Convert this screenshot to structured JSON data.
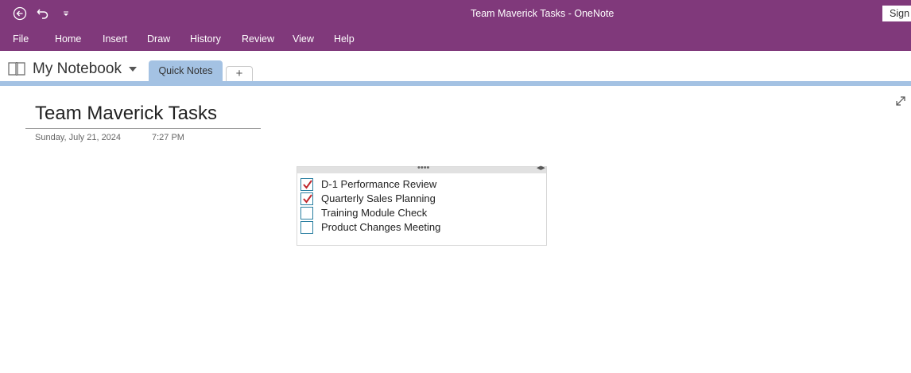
{
  "window": {
    "title": "Team Maverick Tasks  -  OneNote",
    "signin_label": "Sign"
  },
  "menu": {
    "items": [
      "File",
      "Home",
      "Insert",
      "Draw",
      "History",
      "Review",
      "View",
      "Help"
    ]
  },
  "notebook": {
    "name": "My Notebook",
    "active_tab": "Quick Notes",
    "add_tab_label": "+"
  },
  "page": {
    "title": "Team Maverick Tasks",
    "date": "Sunday, July 21, 2024",
    "time": "7:27 PM"
  },
  "todos": [
    {
      "text": "D-1 Performance Review",
      "checked": true
    },
    {
      "text": "Quarterly Sales Planning",
      "checked": true
    },
    {
      "text": "Training Module Check",
      "checked": false
    },
    {
      "text": "Product Changes Meeting",
      "checked": false
    }
  ],
  "colors": {
    "ribbon": "#80397b",
    "section_tab": "#a4c2e3",
    "checkmark": "#c0282d",
    "checkbox_border": "#2a7fa1"
  },
  "icons": {
    "back": "back-circle-icon",
    "undo": "undo-icon",
    "customize": "quick-access-dropdown-icon",
    "notebook": "notebook-icon",
    "expand": "expand-diagonal-icon"
  }
}
